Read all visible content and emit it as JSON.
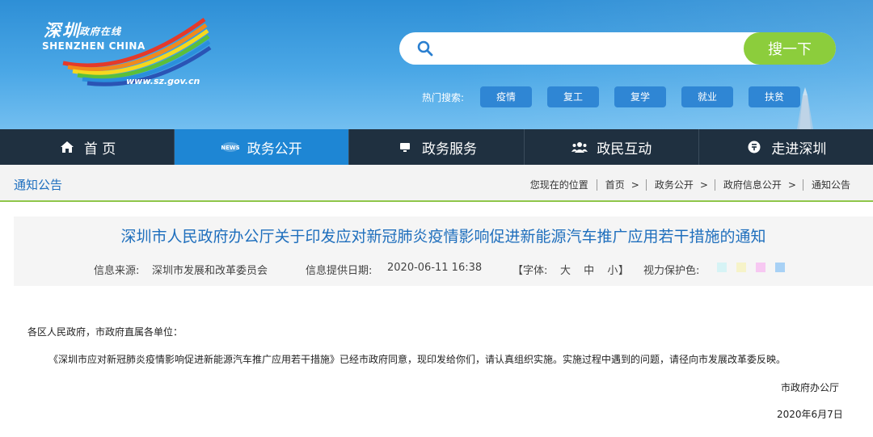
{
  "header": {
    "logo_cn": "深圳",
    "logo_cn_small": "政府在线",
    "logo_en": "SHENZHEN CHINA",
    "logo_url": "www.sz.gov.cn"
  },
  "search": {
    "placeholder": "",
    "value": "",
    "button_label": "搜一下"
  },
  "hot_search": {
    "label": "热门搜索:",
    "tags": [
      "疫情",
      "复工",
      "复学",
      "就业",
      "扶贫"
    ]
  },
  "nav": {
    "items": [
      {
        "label": "首 页",
        "icon": "home-icon"
      },
      {
        "label": "政务公开",
        "icon": "news-icon"
      },
      {
        "label": "政务服务",
        "icon": "monitor-icon"
      },
      {
        "label": "政民互动",
        "icon": "people-icon"
      },
      {
        "label": "走进深圳",
        "icon": "info-icon"
      }
    ],
    "active_index": 1
  },
  "section": {
    "title": "通知公告"
  },
  "breadcrumb": {
    "prefix": "您现在的位置",
    "items": [
      "首页",
      "政务公开",
      "政府信息公开",
      "通知公告"
    ],
    "separator": ">"
  },
  "article": {
    "title": "深圳市人民政府办公厅关于印发应对新冠肺炎疫情影响促进新能源汽车推广应用若干措施的通知",
    "source_label": "信息来源:",
    "source": "深圳市发展和改革委员会",
    "date_label": "信息提供日期:",
    "date": "2020-06-11 16:38",
    "font_label": "【字体:",
    "font_large": "大",
    "font_medium": "中",
    "font_small": "小",
    "font_close": "】",
    "eye_label": "视力保护色:",
    "eye_colors": [
      "#d6f3f5",
      "#f6f3c9",
      "#f7c8f2",
      "#a8d1f5"
    ]
  },
  "body": {
    "salutation": "各区人民政府，市政府直属各单位：",
    "paragraph": "《深圳市应对新冠肺炎疫情影响促进新能源汽车推广应用若干措施》已经市政府同意，现印发给你们，请认真组织实施。实施过程中遇到的问题，请径向市发展改革委反映。",
    "signature": "市政府办公厅",
    "sign_date": "2020年6月7日"
  }
}
